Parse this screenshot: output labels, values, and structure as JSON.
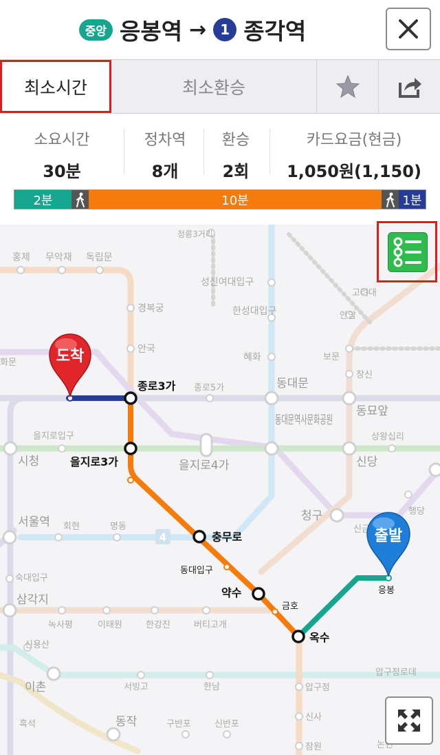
{
  "header": {
    "from_line_badge": "중앙",
    "from_station": "응봉역",
    "arrow": "→",
    "to_line_badge": "1",
    "to_station": "종각역"
  },
  "tabs": {
    "min_time": "최소시간",
    "min_transfer": "최소환승"
  },
  "summary": {
    "time_label": "소요시간",
    "time_value": "30분",
    "stops_label": "정차역",
    "stops_value": "8개",
    "transfer_label": "환승",
    "transfer_value": "2회",
    "fare_label": "카드요금(현금)",
    "fare_value": "1,050원(1,150)"
  },
  "timeline": {
    "seg1": "2분",
    "seg2": "10분",
    "seg3": "1분"
  },
  "map": {
    "pin_arrive": "도착",
    "pin_depart": "출발",
    "stations_main": [
      "종로3가",
      "을지로3가",
      "충무로",
      "약수",
      "옥수"
    ],
    "stations_small": [
      "동대입구",
      "금호",
      "응봉"
    ],
    "stations_bg": [
      "홍제",
      "무악재",
      "독립문",
      "경복궁",
      "안국",
      "정릉3거리",
      "성신여대입구",
      "한성대입구",
      "혜화",
      "종로5가",
      "동대문",
      "동대문역사문화공원",
      "을지로입구",
      "시청",
      "을지로4가",
      "서울역",
      "회현",
      "명동",
      "숙대입구",
      "삼각지",
      "녹사평",
      "이태원",
      "한강진",
      "버티고개",
      "신용산",
      "이촌",
      "서빙고",
      "한남",
      "흑석",
      "동작",
      "구반포",
      "신반포",
      "압구정",
      "신사",
      "잠원",
      "고려대",
      "안암",
      "보문",
      "창신",
      "동묘앞",
      "상왕십리",
      "신당",
      "청구",
      "행당",
      "신금",
      "압구정로데",
      "논현",
      "화문",
      "4"
    ]
  },
  "colors": {
    "jungang": "#16a58e",
    "line1": "#263c96",
    "line3": "#f47b0c",
    "close_border": "#8b8b8b",
    "highlight": "#e01b1b"
  }
}
